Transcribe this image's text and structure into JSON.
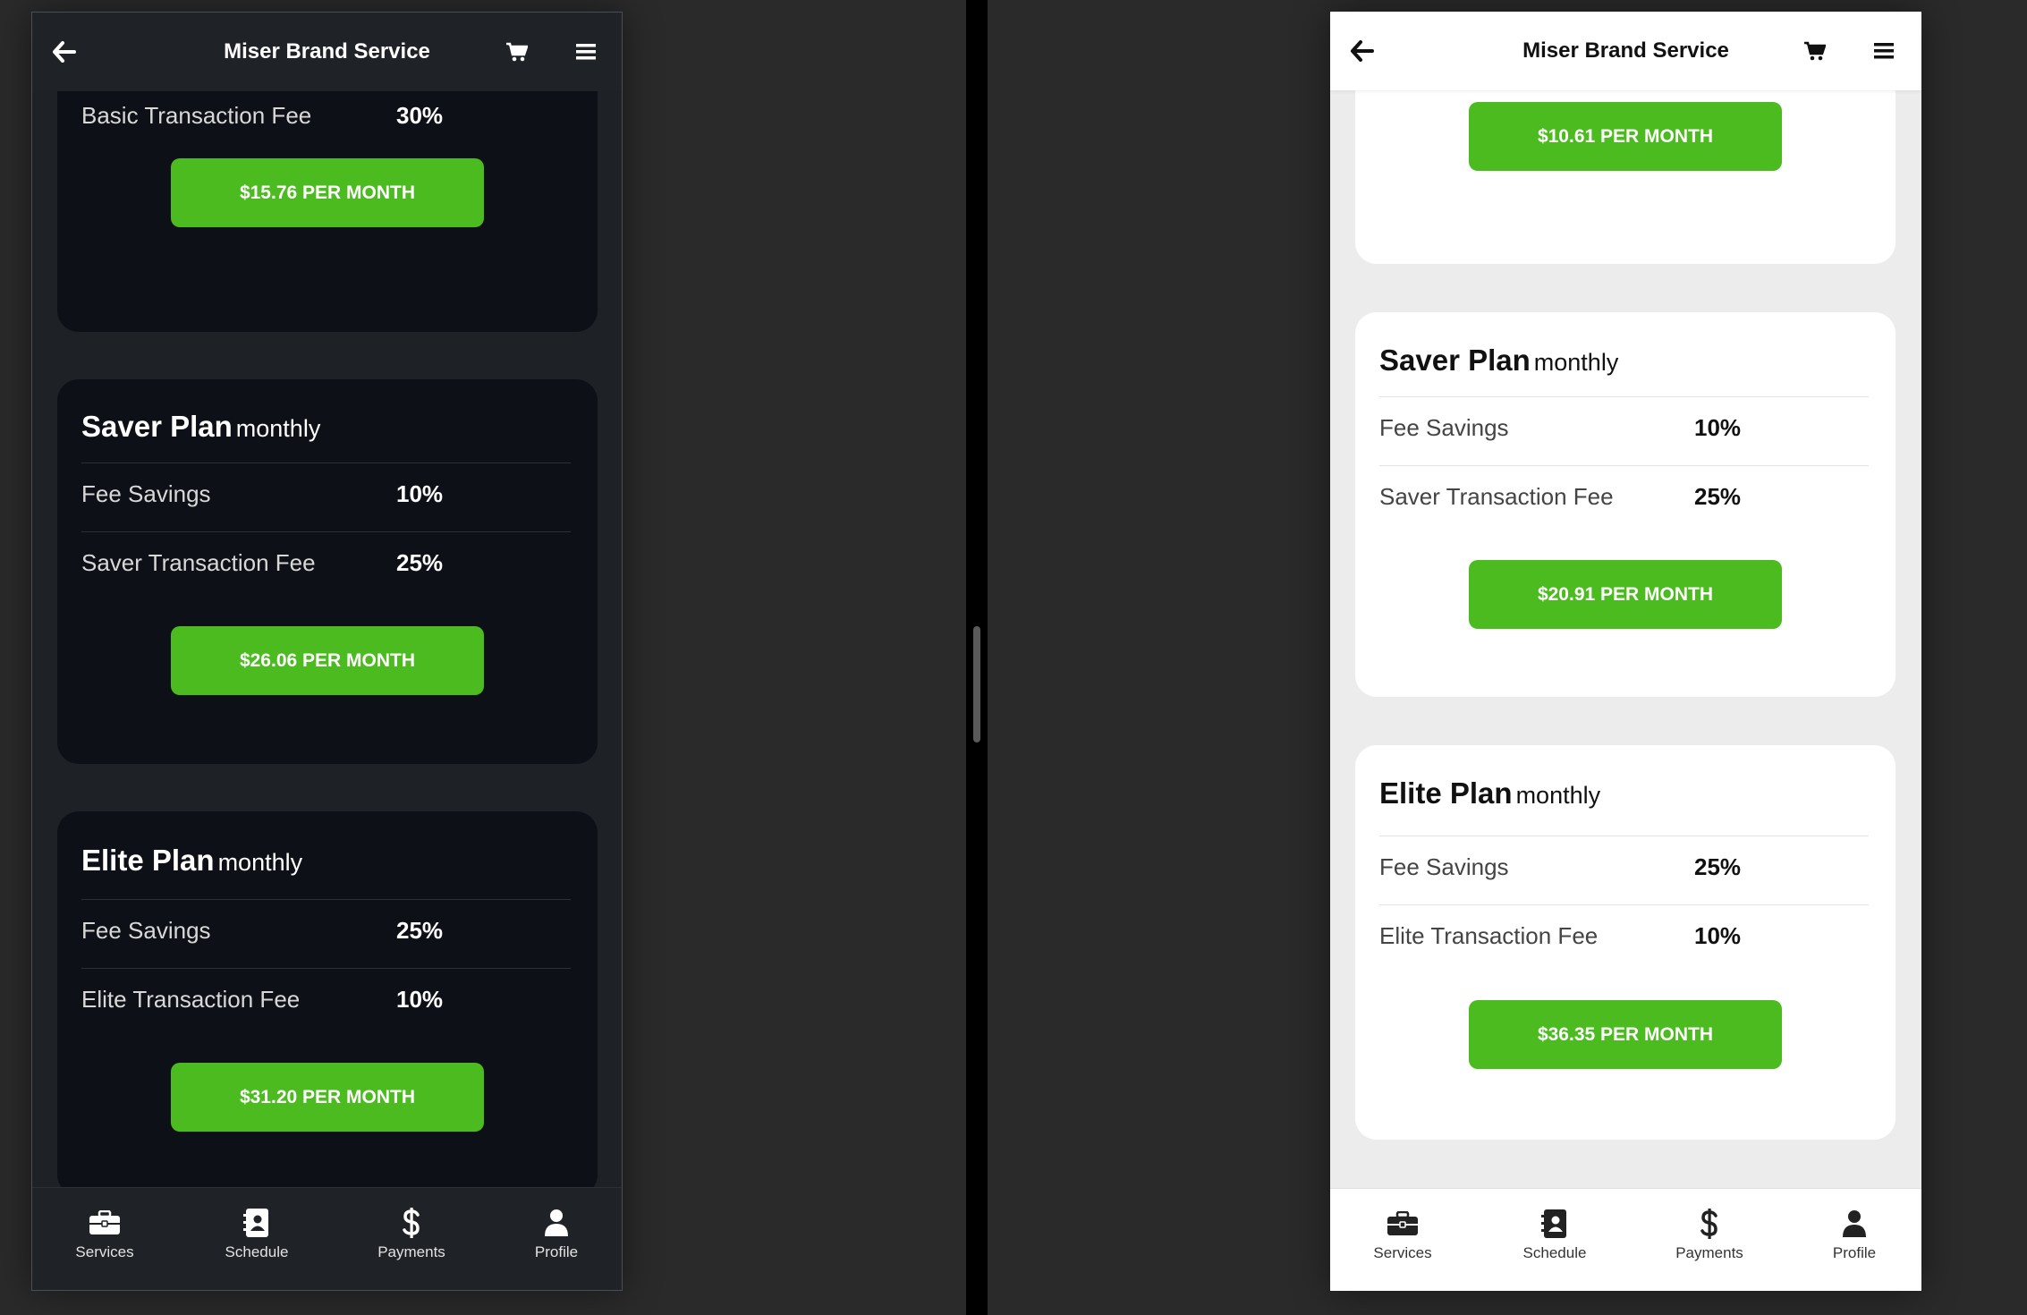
{
  "colors": {
    "accent_green": "#4cbb1f",
    "dark_background": "#1e2126",
    "dark_card": "#0d1117",
    "light_background": "#ececec",
    "light_card": "#ffffff"
  },
  "dark_panel": {
    "header": {
      "title": "Miser Brand Service",
      "icons": [
        "back-arrow-icon",
        "cart-icon",
        "menu-icon"
      ]
    },
    "partial_card": {
      "fee_label": "Basic Transaction Fee",
      "fee_value": "30%",
      "price_label": "$15.76 PER MONTH"
    },
    "saver": {
      "name": "Saver Plan",
      "period": "monthly",
      "rows": [
        {
          "label": "Fee Savings",
          "value": "10%"
        },
        {
          "label": "Saver Transaction Fee",
          "value": "25%"
        }
      ],
      "price_label": "$26.06 PER MONTH"
    },
    "elite": {
      "name": "Elite Plan",
      "period": "monthly",
      "rows": [
        {
          "label": "Fee Savings",
          "value": "25%"
        },
        {
          "label": "Elite Transaction Fee",
          "value": "10%"
        }
      ],
      "price_label": "$31.20 PER MONTH"
    },
    "nav": [
      {
        "label": "Services",
        "icon": "briefcase-icon"
      },
      {
        "label": "Schedule",
        "icon": "contact-book-icon"
      },
      {
        "label": "Payments",
        "icon": "dollar-icon"
      },
      {
        "label": "Profile",
        "icon": "user-icon"
      }
    ]
  },
  "light_panel": {
    "header": {
      "title": "Miser Brand Service",
      "icons": [
        "back-arrow-icon",
        "cart-icon",
        "menu-icon"
      ]
    },
    "partial_card": {
      "price_label": "$10.61 PER MONTH"
    },
    "saver": {
      "name": "Saver Plan",
      "period": "monthly",
      "rows": [
        {
          "label": "Fee Savings",
          "value": "10%"
        },
        {
          "label": "Saver Transaction Fee",
          "value": "25%"
        }
      ],
      "price_label": "$20.91 PER MONTH"
    },
    "elite": {
      "name": "Elite Plan",
      "period": "monthly",
      "rows": [
        {
          "label": "Fee Savings",
          "value": "25%"
        },
        {
          "label": "Elite Transaction Fee",
          "value": "10%"
        }
      ],
      "price_label": "$36.35 PER MONTH"
    },
    "nav": [
      {
        "label": "Services",
        "icon": "briefcase-icon"
      },
      {
        "label": "Schedule",
        "icon": "contact-book-icon"
      },
      {
        "label": "Payments",
        "icon": "dollar-icon"
      },
      {
        "label": "Profile",
        "icon": "user-icon"
      }
    ]
  }
}
